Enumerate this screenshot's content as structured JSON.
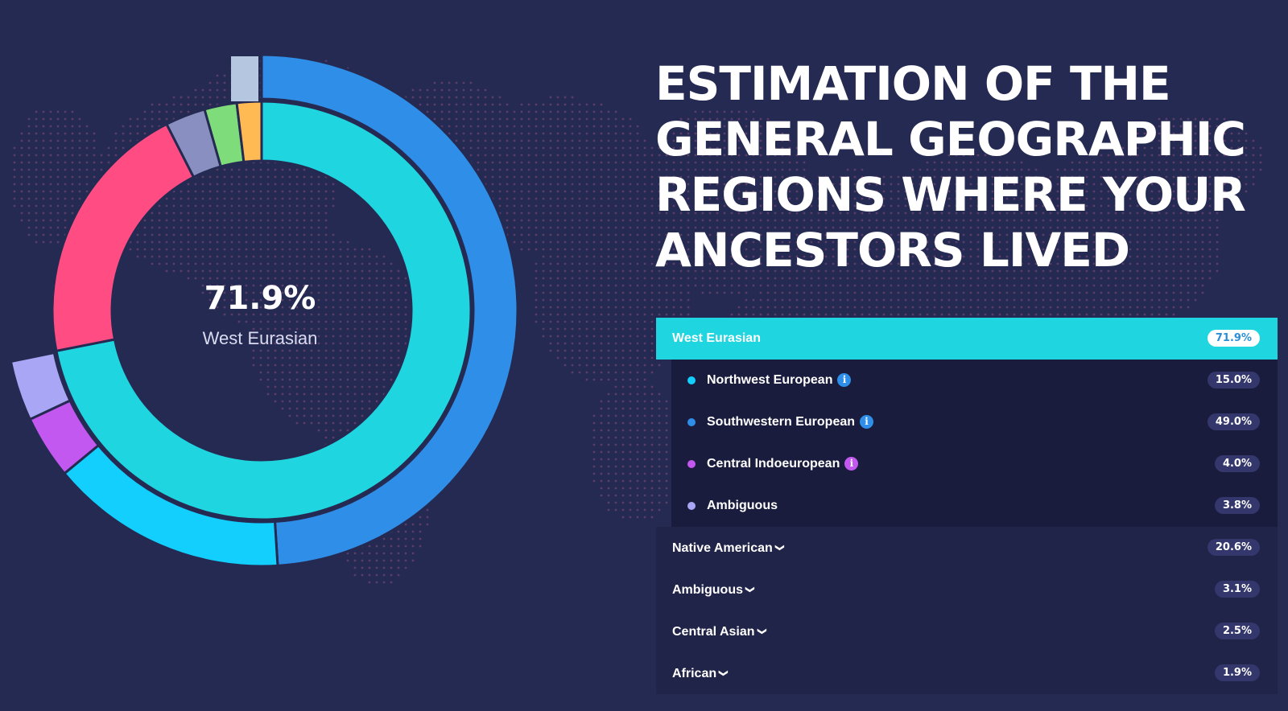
{
  "chart_data": {
    "type": "pie",
    "center_value": "71.9%",
    "center_label": "West Eurasian",
    "inner": [
      {
        "name": "West Eurasian",
        "value": 71.9,
        "color": "#1fd6e0"
      },
      {
        "name": "Native American",
        "value": 20.6,
        "color": "#ff4d84"
      },
      {
        "name": "Ambiguous",
        "value": 3.1,
        "color": "#8a8fc1"
      },
      {
        "name": "Central Asian",
        "value": 2.5,
        "color": "#7fdc7a"
      },
      {
        "name": "African",
        "value": 1.9,
        "color": "#ffba54"
      }
    ],
    "outer": [
      {
        "name": "Southwestern European",
        "value": 49.0,
        "color": "#2f8fe8"
      },
      {
        "name": "Northwest European",
        "value": 15.0,
        "color": "#13cffe"
      },
      {
        "name": "Central Indoeuropean",
        "value": 4.0,
        "color": "#c258ef"
      },
      {
        "name": "Ambiguous",
        "value": 3.8,
        "color": "#a9a7f5"
      },
      {
        "name": "other",
        "value": 28.1,
        "color": "none"
      },
      {
        "name": "top-marker",
        "value": 0.0,
        "color": "#b5c6e0"
      }
    ]
  },
  "title_lines": [
    "ESTIMATION OF THE",
    "GENERAL GEOGRAPHIC",
    "REGIONS WHERE YOUR",
    "ANCESTORS LIVED"
  ],
  "list": {
    "top": {
      "label": "West Eurasian",
      "value": "71.9%"
    },
    "subs": [
      {
        "label": "Northwest European",
        "value": "15.0%",
        "color": "#13cffe",
        "info": true
      },
      {
        "label": "Southwestern European",
        "value": "49.0%",
        "color": "#2f8fe8",
        "info": true
      },
      {
        "label": "Central Indoeuropean",
        "value": "4.0%",
        "color": "#c258ef",
        "info": true
      },
      {
        "label": "Ambiguous",
        "value": "3.8%",
        "color": "#a9a7f5",
        "info": false
      }
    ],
    "groups": [
      {
        "label": "Native American",
        "value": "20.6%"
      },
      {
        "label": "Ambiguous",
        "value": "3.1%"
      },
      {
        "label": "Central Asian",
        "value": "2.5%"
      },
      {
        "label": "African",
        "value": "1.9%"
      }
    ],
    "info_icon": "info-icon",
    "chevron_icon": "chevron-down-icon"
  }
}
